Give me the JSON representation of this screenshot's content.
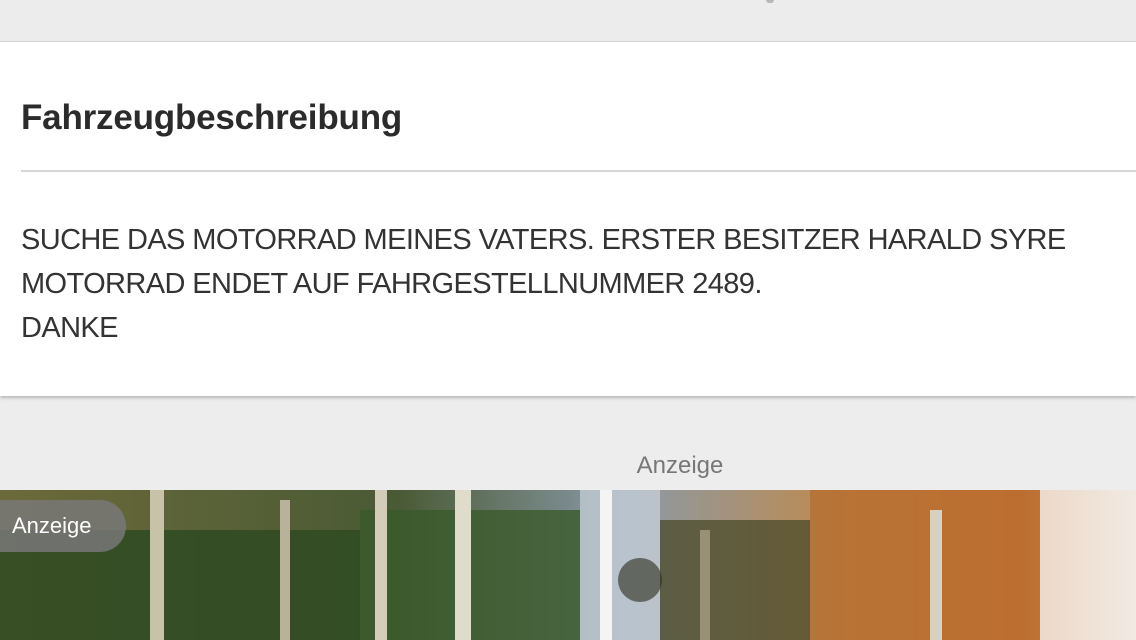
{
  "vehicle_description": {
    "title": "Fahrzeugbeschreibung",
    "lines": [
      "SUCHE DAS MOTORRAD MEINES VATERS. ERSTER BESITZER HARALD SYRE",
      "MOTORRAD ENDET AUF FAHRGESTELLNUMMER 2489.",
      "DANKE"
    ]
  },
  "advertisement": {
    "section_label": "Anzeige",
    "badge_label": "Anzeige",
    "image_description_icon": "forest-scene-image"
  },
  "colors": {
    "page_background": "#ededed",
    "card_background": "#ffffff",
    "title_text": "#2b2b2b",
    "body_text": "#333333",
    "muted_text": "#777777"
  }
}
